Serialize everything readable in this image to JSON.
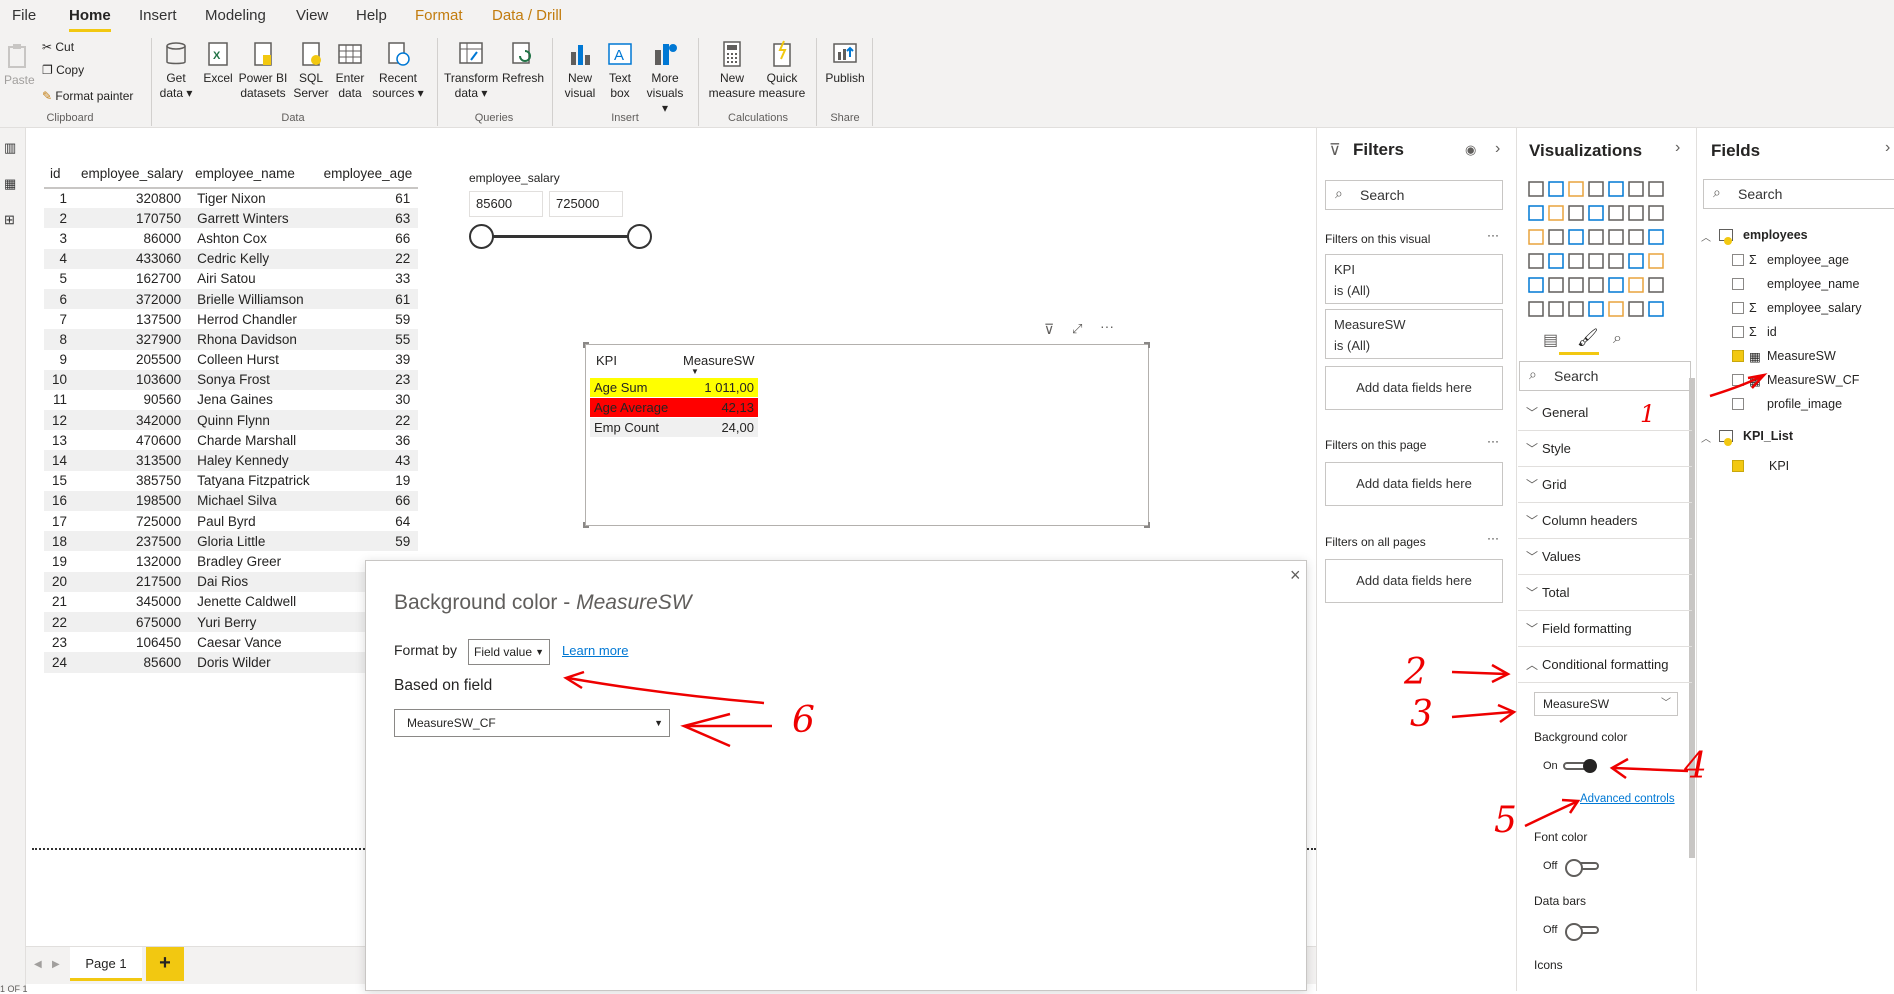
{
  "menu": {
    "file": "File",
    "home": "Home",
    "insert": "Insert",
    "modeling": "Modeling",
    "view": "View",
    "help": "Help",
    "format": "Format",
    "data_drill": "Data / Drill"
  },
  "ribbon": {
    "paste": "Paste",
    "cut": "Cut",
    "copy": "Copy",
    "format_painter": "Format painter",
    "clipboard": "Clipboard",
    "get_data": "Get data",
    "excel": "Excel",
    "pbi_datasets": "Power BI datasets",
    "sql_server": "SQL Server",
    "enter_data": "Enter data",
    "recent_sources": "Recent sources",
    "data": "Data",
    "transform_data": "Transform data",
    "refresh": "Refresh",
    "queries": "Queries",
    "new_visual": "New visual",
    "text_box": "Text box",
    "more_visuals": "More visuals",
    "insert": "Insert",
    "new_measure": "New measure",
    "quick_measure": "Quick measure",
    "calculations": "Calculations",
    "publish": "Publish",
    "share": "Share"
  },
  "table": {
    "headers": [
      "id",
      "employee_salary",
      "employee_name",
      "employee_age"
    ],
    "rows": [
      [
        "1",
        "320800",
        "Tiger Nixon",
        "61"
      ],
      [
        "2",
        "170750",
        "Garrett Winters",
        "63"
      ],
      [
        "3",
        "86000",
        "Ashton Cox",
        "66"
      ],
      [
        "4",
        "433060",
        "Cedric Kelly",
        "22"
      ],
      [
        "5",
        "162700",
        "Airi Satou",
        "33"
      ],
      [
        "6",
        "372000",
        "Brielle Williamson",
        "61"
      ],
      [
        "7",
        "137500",
        "Herrod Chandler",
        "59"
      ],
      [
        "8",
        "327900",
        "Rhona Davidson",
        "55"
      ],
      [
        "9",
        "205500",
        "Colleen Hurst",
        "39"
      ],
      [
        "10",
        "103600",
        "Sonya Frost",
        "23"
      ],
      [
        "11",
        "90560",
        "Jena Gaines",
        "30"
      ],
      [
        "12",
        "342000",
        "Quinn Flynn",
        "22"
      ],
      [
        "13",
        "470600",
        "Charde Marshall",
        "36"
      ],
      [
        "14",
        "313500",
        "Haley Kennedy",
        "43"
      ],
      [
        "15",
        "385750",
        "Tatyana Fitzpatrick",
        "19"
      ],
      [
        "16",
        "198500",
        "Michael Silva",
        "66"
      ],
      [
        "17",
        "725000",
        "Paul Byrd",
        "64"
      ],
      [
        "18",
        "237500",
        "Gloria Little",
        "59"
      ],
      [
        "19",
        "132000",
        "Bradley Greer",
        ""
      ],
      [
        "20",
        "217500",
        "Dai Rios",
        ""
      ],
      [
        "21",
        "345000",
        "Jenette Caldwell",
        ""
      ],
      [
        "22",
        "675000",
        "Yuri Berry",
        ""
      ],
      [
        "23",
        "106450",
        "Caesar Vance",
        ""
      ],
      [
        "24",
        "85600",
        "Doris Wilder",
        ""
      ]
    ]
  },
  "slicer": {
    "title": "employee_salary",
    "min": "85600",
    "max": "725000"
  },
  "kpi": {
    "headers": [
      "KPI",
      "MeasureSW"
    ],
    "rows": [
      {
        "label": "Age Sum",
        "value": "1 011,00",
        "bg": "#ffff00"
      },
      {
        "label": "Age Average",
        "value": "42,13",
        "bg": "#ff0000"
      },
      {
        "label": "Emp Count",
        "value": "24,00",
        "bg": "#f0f0f0"
      }
    ]
  },
  "dialog": {
    "title": "Background color - ",
    "title_italic": "MeasureSW",
    "format_by_label": "Format by",
    "format_by_value": "Field value",
    "learn_more": "Learn more",
    "based_on_label": "Based on field",
    "based_on_value": "MeasureSW_CF"
  },
  "pages": {
    "page1": "Page 1",
    "add": "+"
  },
  "filters": {
    "title": "Filters",
    "search": "Search",
    "on_visual": "Filters on this visual",
    "card1_name": "KPI",
    "card1_state": "is (All)",
    "card2_name": "MeasureSW",
    "card2_state": "is (All)",
    "add_fields": "Add data fields here",
    "on_page": "Filters on this page",
    "on_all": "Filters on all pages",
    "more": "···"
  },
  "visualizations": {
    "title": "Visualizations",
    "search": "Search",
    "sections": [
      "General",
      "Style",
      "Grid",
      "Column headers",
      "Values",
      "Total",
      "Field formatting",
      "Conditional formatting"
    ],
    "cf_dropdown": "MeasureSW",
    "bg_color": "Background color",
    "on": "On",
    "advanced": "Advanced controls",
    "font_color": "Font color",
    "off": "Off",
    "data_bars": "Data bars",
    "icons": "Icons"
  },
  "fields": {
    "title": "Fields",
    "search": "Search",
    "table1": "employees",
    "items": [
      {
        "name": "employee_age",
        "sigma": "Σ",
        "checked": false
      },
      {
        "name": "employee_name",
        "sigma": "",
        "checked": false
      },
      {
        "name": "employee_salary",
        "sigma": "Σ",
        "checked": false
      },
      {
        "name": "id",
        "sigma": "Σ",
        "checked": false
      },
      {
        "name": "MeasureSW",
        "sigma": "calc",
        "checked": true
      },
      {
        "name": "MeasureSW_CF",
        "sigma": "calc",
        "checked": false
      },
      {
        "name": "profile_image",
        "sigma": "",
        "checked": false
      }
    ],
    "table2": "KPI_List",
    "table2_item": "KPI"
  },
  "annotations": {
    "n1": "1",
    "n2": "2",
    "n3": "3",
    "n4": "4",
    "n5": "5",
    "n6": "6"
  },
  "status": "1 OF 1"
}
